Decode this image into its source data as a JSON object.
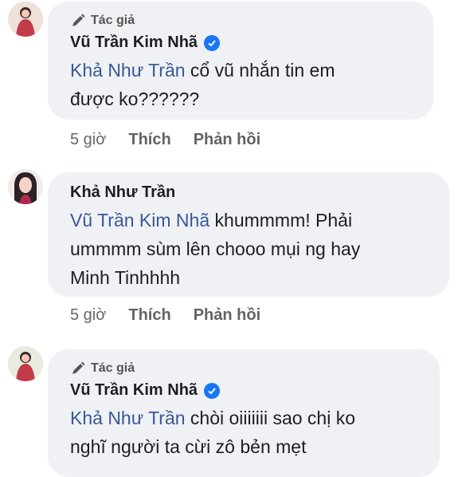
{
  "comments": [
    {
      "badge": "Tác giả",
      "author": "Vũ Trần Kim Nhã",
      "verified": true,
      "mention": "Khả Như Trần",
      "line1_rest": " cổ vũ nhắn tin em",
      "line2": "được ko??????",
      "time": "5 giờ",
      "like": "Thích",
      "reply": "Phản hồi"
    },
    {
      "author": "Khả Như Trần",
      "mention": "Vũ Trần Kim Nhã",
      "line1_rest": " khummmm! Phải",
      "line2": "ummmm sùm lên chooo mụi ng hay",
      "line3": "Minh Tinhhhh",
      "time": "5 giờ",
      "like": "Thích",
      "reply": "Phản hồi"
    },
    {
      "badge": "Tác giả",
      "author": "Vũ Trần Kim Nhã",
      "verified": true,
      "mention": "Khả Như Trần",
      "line1_rest": " chòi oiiiiiii sao chị ko",
      "line2": "nghĩ người ta cừi zô bẻn mẹt"
    }
  ],
  "colors": {
    "mention": "#385898",
    "bubble": "#eff1f4",
    "verified": "#1877f2"
  },
  "icons": {
    "badge": "pencil-icon",
    "verified": "verified-check-icon"
  }
}
